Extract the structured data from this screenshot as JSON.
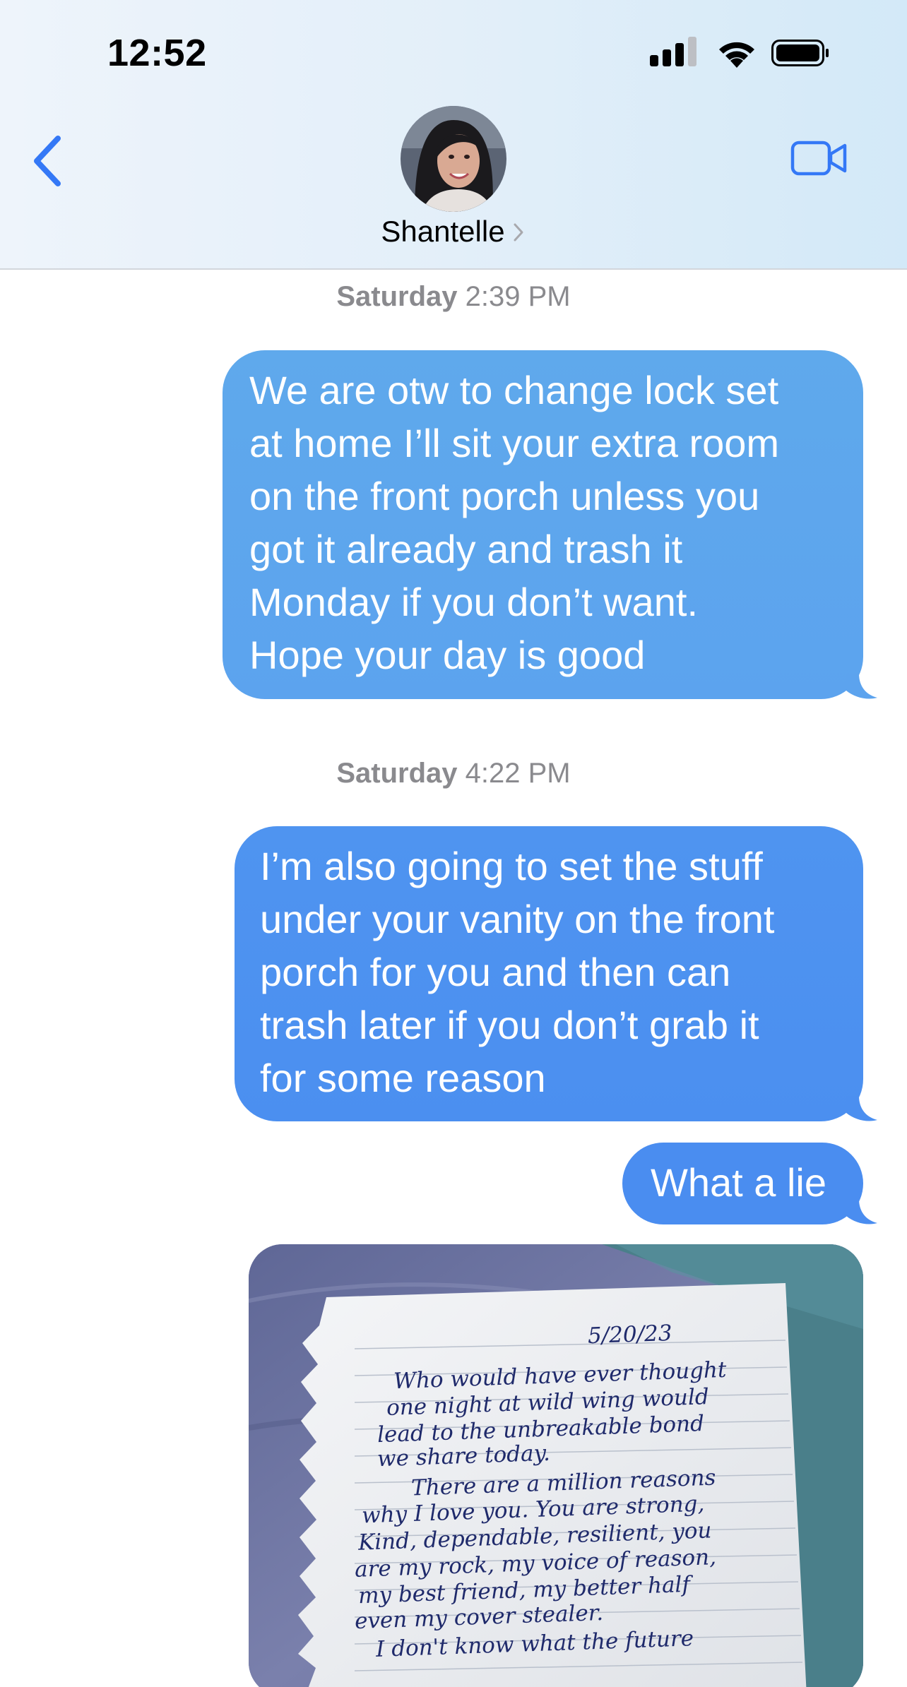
{
  "status_bar": {
    "time": "12:52"
  },
  "header": {
    "contact_name": "Shantelle",
    "icons": [
      "back-chevron-icon",
      "video-camera-icon",
      "chevron-right-icon"
    ]
  },
  "messages": [
    {
      "type": "timestamp",
      "day": "Saturday",
      "time": "2:39 PM"
    },
    {
      "type": "sent",
      "text": "We are otw to change lock set\nat home I’ll sit your extra room\non the front porch unless you\ngot it already and trash it\nMonday if you don’t want.\nHope your day is good"
    },
    {
      "type": "timestamp",
      "day": "Saturday",
      "time": "4:22 PM"
    },
    {
      "type": "sent",
      "text": "I’m also going to set the stuff\nunder your vanity on the front\nporch for you and then can\ntrash later if you don’t grab it\nfor some reason"
    },
    {
      "type": "sent",
      "text": "What a lie"
    },
    {
      "type": "photo",
      "handwritten_note": [
        "5/20/23",
        "Who would have ever thought",
        "one night at wild wing would",
        "lead to the unbreakable bond",
        "we share today.",
        "There are a million reasons",
        "why I love you. You are strong,",
        "Kind, dependable, resilient, you",
        "are my rock, my voice of reason,",
        "my best friend, my better half",
        "even my cover stealer.",
        "I don't know what the future"
      ]
    }
  ],
  "colors": {
    "bubble_blue": "#4d8ff1",
    "ios_blue": "#3478f6",
    "timestamp_gray": "#8a8a8e"
  }
}
